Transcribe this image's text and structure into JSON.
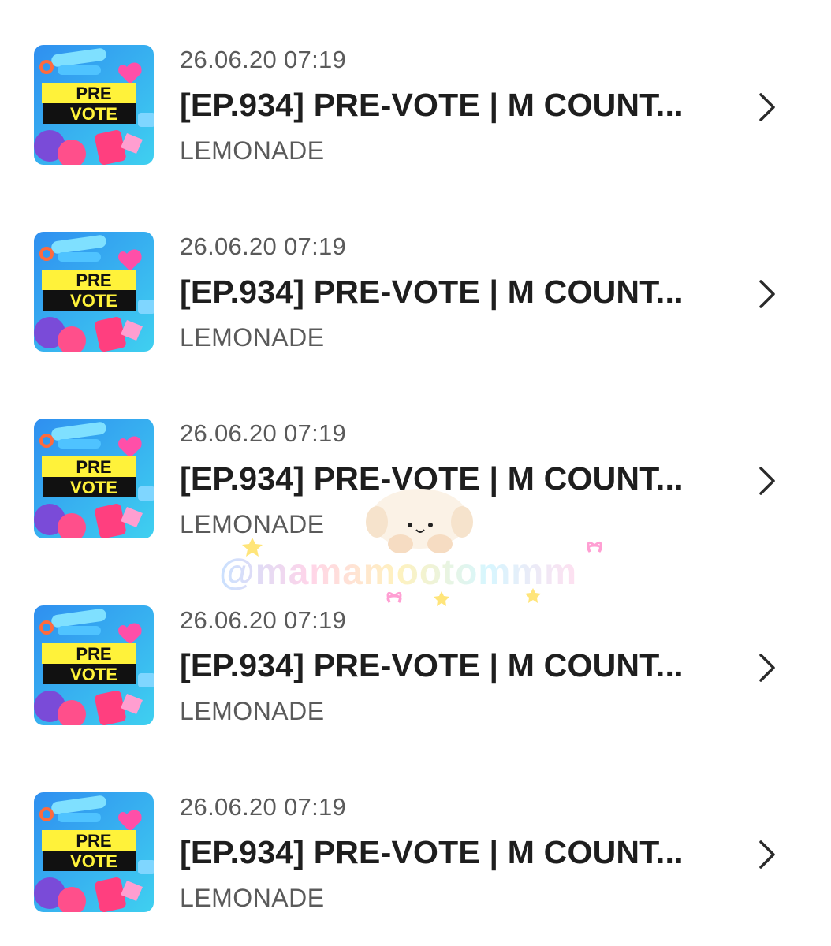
{
  "items": [
    {
      "date": "26.06.20 07:19",
      "title": "[EP.934] PRE-VOTE | M COUNT...",
      "artist": "LEMONADE",
      "thumb_label_top": "PRE",
      "thumb_label_bottom": "VOTE"
    },
    {
      "date": "26.06.20 07:19",
      "title": "[EP.934] PRE-VOTE | M COUNT...",
      "artist": "LEMONADE",
      "thumb_label_top": "PRE",
      "thumb_label_bottom": "VOTE"
    },
    {
      "date": "26.06.20 07:19",
      "title": "[EP.934] PRE-VOTE | M COUNT...",
      "artist": "LEMONADE",
      "thumb_label_top": "PRE",
      "thumb_label_bottom": "VOTE"
    },
    {
      "date": "26.06.20 07:19",
      "title": "[EP.934] PRE-VOTE | M COUNT...",
      "artist": "LEMONADE",
      "thumb_label_top": "PRE",
      "thumb_label_bottom": "VOTE"
    },
    {
      "date": "26.06.20 07:19",
      "title": "[EP.934] PRE-VOTE | M COUNT...",
      "artist": "LEMONADE",
      "thumb_label_top": "PRE",
      "thumb_label_bottom": "VOTE"
    }
  ],
  "watermark": {
    "text": "@mamamootommm",
    "icon": "puppy-sticker"
  },
  "colors": {
    "thumb_bg": "#35b6f0",
    "thumb_label_yellow": "#fff23a",
    "thumb_label_black": "#111111",
    "thumb_pink": "#ff4f8b",
    "thumb_purple": "#7a4bd8",
    "text_primary": "#1e1e1e",
    "text_secondary": "#5a5a5a"
  }
}
